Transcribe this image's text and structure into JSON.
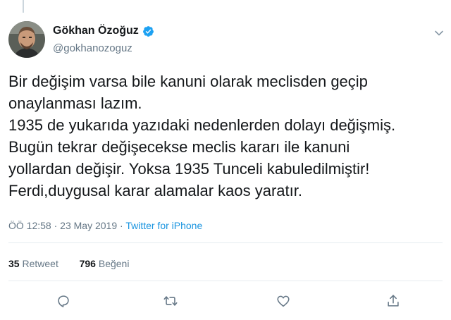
{
  "author": {
    "name": "Gökhan Özoğuz",
    "handle": "@gokhanozoguz",
    "verified": true
  },
  "tweet": {
    "lines": [
      "Bir değişim varsa bile kanuni olarak meclisden geçip",
      "onaylanması lazım.",
      "1935 de yukarıda yazıdaki nedenlerden dolayı değişmiş.",
      "Bugün tekrar değişecekse meclis kararı ile kanuni",
      "yollardan değişir. Yoksa 1935 Tunceli kabuledilmiştir!",
      "Ferdi,duygusal karar alamalar kaos yaratır."
    ]
  },
  "meta": {
    "time": "ÖÖ 12:58",
    "date": "23 May 2019",
    "separator": "·",
    "source": "Twitter for iPhone"
  },
  "stats": {
    "retweets_count": "35",
    "retweets_label": "Retweet",
    "likes_count": "796",
    "likes_label": "Beğeni"
  },
  "colors": {
    "text": "#14171a",
    "muted": "#657786",
    "link": "#1b95e0",
    "verified": "#1da1f2",
    "divider": "#e6ecf0"
  },
  "icons": [
    "verified-badge-icon",
    "chevron-down-icon",
    "reply-icon",
    "retweet-icon",
    "like-icon",
    "share-icon"
  ]
}
